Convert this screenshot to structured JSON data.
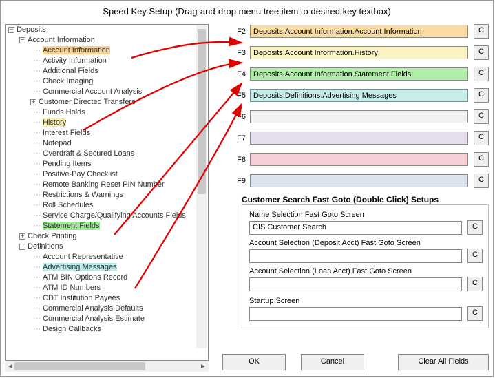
{
  "title": "Speed Key Setup   (Drag-and-drop menu tree item to desired key textbox)",
  "tree": {
    "root": "Deposits",
    "group1": "Account Information",
    "items1": {
      "account_information": "Account Information",
      "activity_information": "Activity Information",
      "additional_fields": "Additional Fields",
      "check_imaging": "Check Imaging",
      "commercial_account_analysis": "Commercial Account Analysis",
      "customer_directed_transfers": "Customer Directed Transfers",
      "funds_holds": "Funds Holds",
      "history": "History",
      "interest_fields": "Interest Fields",
      "notepad": "Notepad",
      "overdraft_secured_loans": "Overdraft & Secured Loans",
      "pending_items": "Pending Items",
      "positive_pay_checklist": "Positive-Pay Checklist",
      "remote_banking_reset_pin": "Remote Banking Reset PIN Number",
      "restrictions_warnings": "Restrictions & Warnings",
      "roll_schedules": "Roll Schedules",
      "service_charge_qual": "Service Charge/Qualifying Accounts Fields",
      "statement_fields": "Statement Fields"
    },
    "group2": "Check Printing",
    "group3": "Definitions",
    "items3": {
      "account_representative": "Account Representative",
      "advertising_messages": "Advertising Messages",
      "atm_bin_options": "ATM BIN Options Record",
      "atm_id_numbers": "ATM ID Numbers",
      "cdt_institution_payees": "CDT Institution Payees",
      "commercial_analysis_defaults": "Commercial Analysis Defaults",
      "commercial_analysis_estimate": "Commercial Analysis Estimate",
      "design_callbacks": "Design Callbacks"
    }
  },
  "keys": {
    "F2": {
      "label": "F2",
      "value": "Deposits.Account Information.Account Information",
      "color": "bg-orange"
    },
    "F3": {
      "label": "F3",
      "value": "Deposits.Account Information.History",
      "color": "bg-yellow"
    },
    "F4": {
      "label": "F4",
      "value": "Deposits.Account Information.Statement Fields",
      "color": "bg-green"
    },
    "F5": {
      "label": "F5",
      "value": "Deposits.Definitions.Advertising Messages",
      "color": "bg-cyan"
    },
    "F6": {
      "label": "F6",
      "value": "",
      "color": "bg-grey"
    },
    "F7": {
      "label": "F7",
      "value": "",
      "color": "bg-lilac"
    },
    "F8": {
      "label": "F8",
      "value": "",
      "color": "bg-pink"
    },
    "F9": {
      "label": "F9",
      "value": "",
      "color": "bg-blue"
    }
  },
  "clear_btn": "C",
  "section": {
    "title": "Customer Search Fast Goto (Double Click) Setups",
    "name_label": "Name Selection Fast Goto Screen",
    "name_value": "CIS.Customer Search",
    "deposit_label": "Account Selection (Deposit Acct) Fast Goto Screen",
    "deposit_value": "",
    "loan_label": "Account Selection (Loan Acct) Fast Goto Screen",
    "loan_value": "",
    "startup_label": "Startup Screen",
    "startup_value": ""
  },
  "buttons": {
    "ok": "OK",
    "cancel": "Cancel",
    "clear_all": "Clear All Fields"
  }
}
